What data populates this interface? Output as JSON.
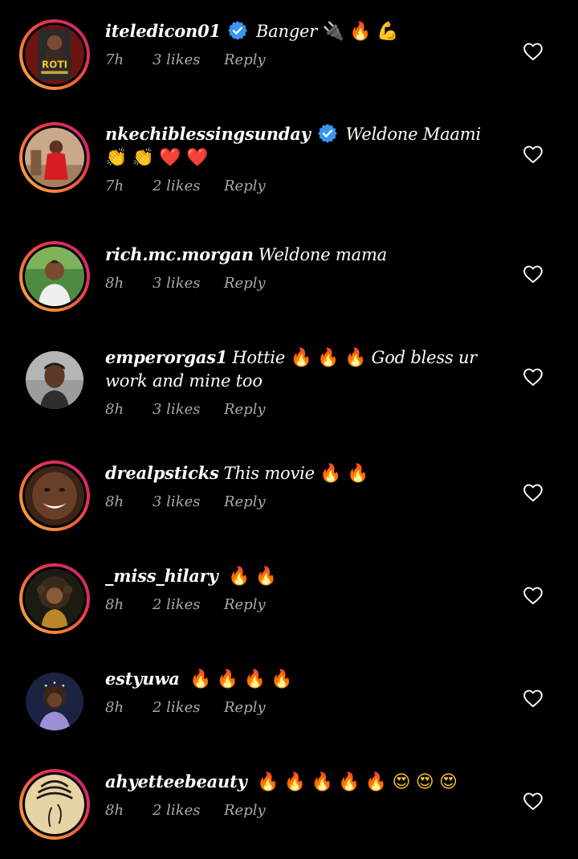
{
  "comments": [
    {
      "username": "iteledicon01",
      "verified": true,
      "text": "Banger",
      "emojis": [
        {
          "char": "🔌",
          "kind": "plug"
        },
        {
          "char": "🔥",
          "kind": "fire"
        },
        {
          "char": "💪",
          "kind": "hand"
        }
      ],
      "time": "7h",
      "likes": "3 likes",
      "reply": "Reply",
      "avatar": "poster",
      "story_ring": true
    },
    {
      "username": "nkechiblessingsunday",
      "verified": true,
      "text": "Weldone Maami",
      "emojis": [
        {
          "char": "👏",
          "kind": "hand"
        },
        {
          "char": "👏",
          "kind": "hand"
        },
        {
          "char": "❤️",
          "kind": "heart"
        },
        {
          "char": "❤️",
          "kind": "heart"
        }
      ],
      "time": "7h",
      "likes": "2 likes",
      "reply": "Reply",
      "avatar": "woman-red",
      "story_ring": true
    },
    {
      "username": "rich.mc.morgan",
      "verified": false,
      "text": "Weldone mama",
      "emojis": [],
      "time": "8h",
      "likes": "3 likes",
      "reply": "Reply",
      "avatar": "man-white",
      "story_ring": true
    },
    {
      "username": "emperorgas1",
      "verified": false,
      "text": "Hottie",
      "emojis": [
        {
          "char": "🔥",
          "kind": "fire"
        },
        {
          "char": "🔥",
          "kind": "fire"
        },
        {
          "char": "🔥",
          "kind": "fire"
        }
      ],
      "text_after": "God bless ur work and mine too",
      "time": "8h",
      "likes": "3 likes",
      "reply": "Reply",
      "avatar": "man-grey",
      "story_ring": false
    },
    {
      "username": "drealpsticks",
      "verified": false,
      "text": "This movie",
      "emojis": [
        {
          "char": "🔥",
          "kind": "fire"
        },
        {
          "char": "🔥",
          "kind": "fire"
        }
      ],
      "time": "8h",
      "likes": "3 likes",
      "reply": "Reply",
      "avatar": "man-smile",
      "story_ring": true
    },
    {
      "username": "_miss_hilary",
      "verified": false,
      "text": "",
      "emojis": [
        {
          "char": "🔥",
          "kind": "fire"
        },
        {
          "char": "🔥",
          "kind": "fire"
        }
      ],
      "time": "8h",
      "likes": "2 likes",
      "reply": "Reply",
      "avatar": "woman-curls",
      "story_ring": true
    },
    {
      "username": "estyuwa",
      "verified": false,
      "text": "",
      "emojis": [
        {
          "char": "🔥",
          "kind": "fire"
        },
        {
          "char": "🔥",
          "kind": "fire"
        },
        {
          "char": "🔥",
          "kind": "fire"
        },
        {
          "char": "🔥",
          "kind": "fire"
        }
      ],
      "time": "8h",
      "likes": "2 likes",
      "reply": "Reply",
      "avatar": "woman-night",
      "story_ring": false
    },
    {
      "username": "ahyetteebeauty",
      "verified": false,
      "text": "",
      "emojis": [
        {
          "char": "🔥",
          "kind": "fire"
        },
        {
          "char": "🔥",
          "kind": "fire"
        },
        {
          "char": "🔥",
          "kind": "fire"
        },
        {
          "char": "🔥",
          "kind": "fire"
        },
        {
          "char": "🔥",
          "kind": "fire"
        },
        {
          "char": "😍",
          "kind": "love"
        },
        {
          "char": "😍",
          "kind": "love"
        },
        {
          "char": "😍",
          "kind": "love"
        }
      ],
      "time": "8h",
      "likes": "2 likes",
      "reply": "Reply",
      "avatar": "braids-art",
      "story_ring": true
    }
  ],
  "colors": {
    "background": "#000000",
    "text": "#ffffff",
    "meta": "#a8a8a8",
    "verified": "#3797f0",
    "story_ring_start": "#f9b53d",
    "story_ring_end": "#c41e7c"
  }
}
